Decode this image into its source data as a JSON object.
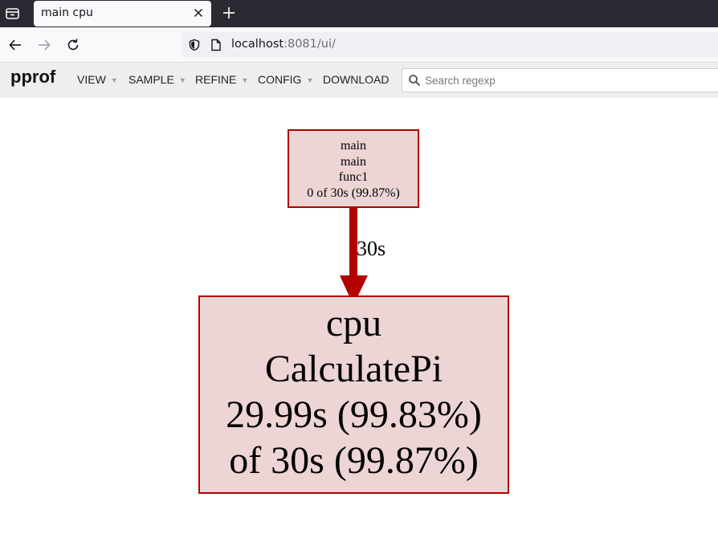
{
  "browser": {
    "tab_title": "main cpu",
    "url_host": "localhost",
    "url_rest": ":8081/ui/"
  },
  "pprof": {
    "logo": "pprof",
    "menu": [
      "VIEW",
      "SAMPLE",
      "REFINE",
      "CONFIG",
      "DOWNLOAD"
    ],
    "search_placeholder": "Search regexp"
  },
  "graph": {
    "caller_node": {
      "lines": [
        "main",
        "main",
        "func1",
        "0 of 30s (99.87%)"
      ]
    },
    "callee_node": {
      "lines": [
        "cpu",
        "CalculatePi",
        "29.99s (99.83%)",
        "of 30s (99.87%)"
      ]
    },
    "edge_label": "30s",
    "node_fill": "#edd5d5",
    "node_border": "#b20000",
    "edge_color": "#b20000"
  },
  "icons": {
    "tab_list": "tab-list-icon",
    "close": "close-icon",
    "new_tab": "plus-icon",
    "back": "back-arrow-icon",
    "forward": "forward-arrow-icon",
    "reload": "reload-icon",
    "shield": "shield-icon",
    "page": "page-icon",
    "search": "search-icon"
  }
}
